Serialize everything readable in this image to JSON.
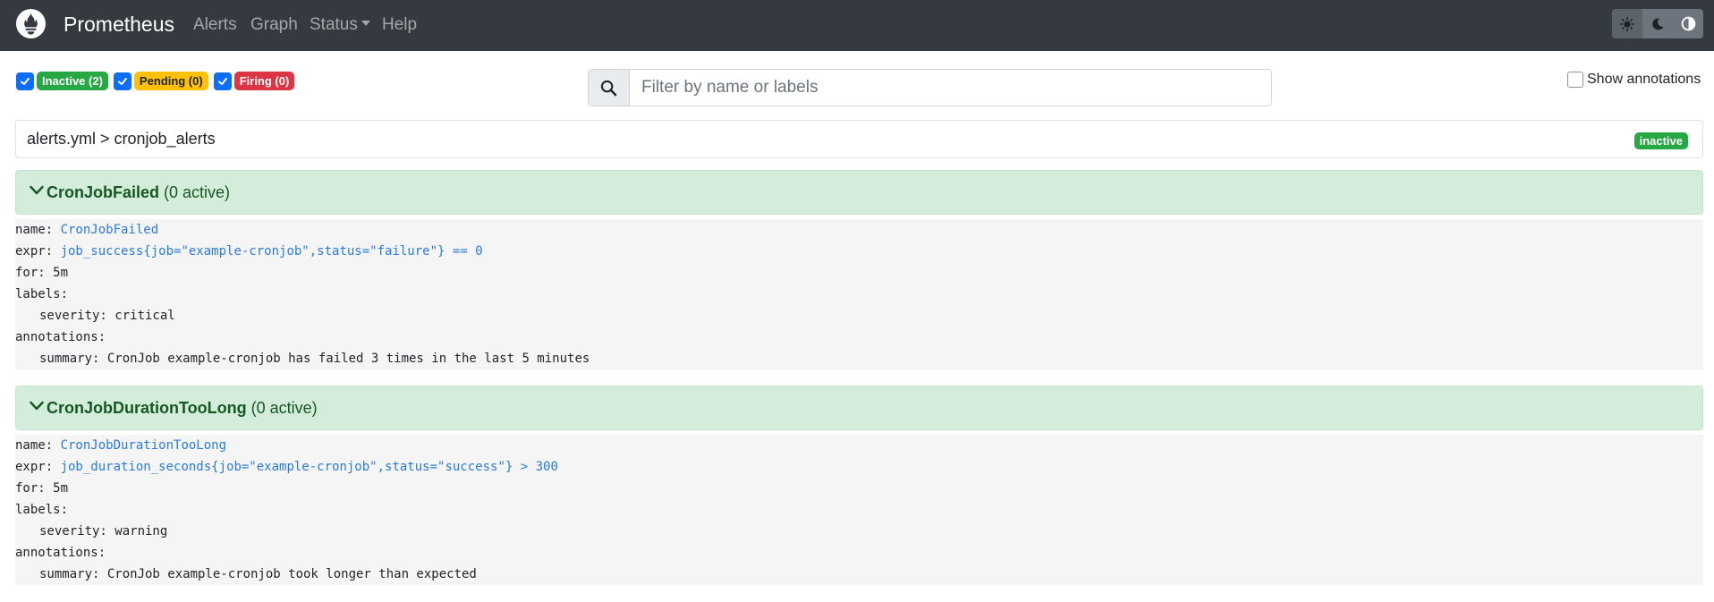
{
  "navbar": {
    "brand": "Prometheus",
    "links": [
      "Alerts",
      "Graph",
      "Status",
      "Help"
    ]
  },
  "filters": {
    "inactive": "Inactive (2)",
    "pending": "Pending (0)",
    "firing": "Firing (0)"
  },
  "search": {
    "placeholder": "Filter by name or labels"
  },
  "show_annotations": "Show annotations",
  "group": {
    "path": "alerts.yml > cronjob_alerts",
    "state": "inactive"
  },
  "rules": [
    {
      "name": "CronJobFailed",
      "active": "(0 active)",
      "lines": {
        "name_key": "name: ",
        "name_val": "CronJobFailed",
        "expr_key": "expr: ",
        "expr_val": "job_success{job=\"example-cronjob\",status=\"failure\"} == 0",
        "for": "for: 5m",
        "labels": "labels:",
        "severity": "severity: critical",
        "annotations": "annotations:",
        "summary": "summary: CronJob example-cronjob has failed 3 times in the last 5 minutes"
      }
    },
    {
      "name": "CronJobDurationTooLong",
      "active": "(0 active)",
      "lines": {
        "name_key": "name: ",
        "name_val": "CronJobDurationTooLong",
        "expr_key": "expr: ",
        "expr_val": "job_duration_seconds{job=\"example-cronjob\",status=\"success\"} > 300",
        "for": "for: 5m",
        "labels": "labels:",
        "severity": "severity: warning",
        "annotations": "annotations:",
        "summary": "summary: CronJob example-cronjob took longer than expected"
      }
    }
  ],
  "colors": {
    "navbar": "#343a40",
    "inactive": "#28a745",
    "pending": "#ffc107",
    "firing": "#dc3545",
    "rule_header": "#d4edda"
  }
}
